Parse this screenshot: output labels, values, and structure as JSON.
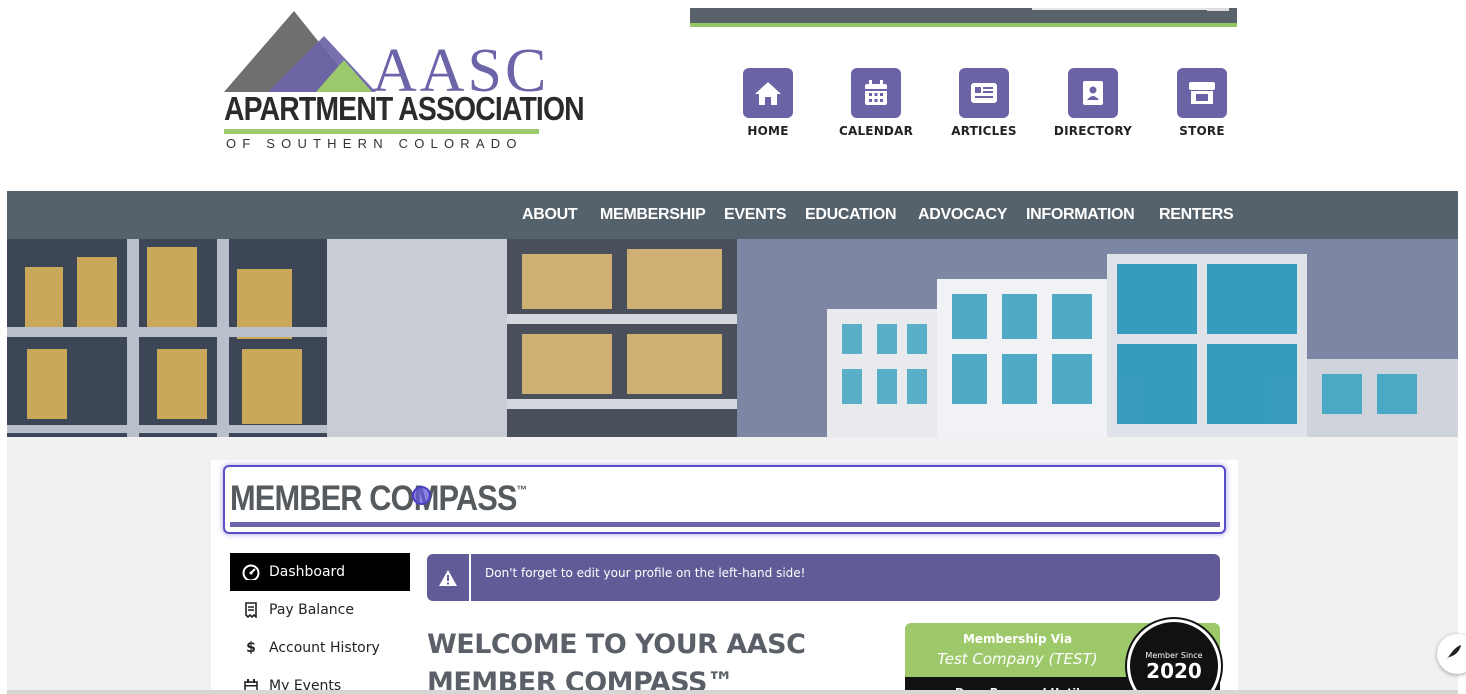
{
  "logo": {
    "abbr": "AASC",
    "line1": "APARTMENT ASSOCIATION",
    "line2": "OF SOUTHERN COLORADO",
    "colors": {
      "purple": "#6b64a8",
      "green": "#9cc96b",
      "gray": "#6f6f6f"
    }
  },
  "quick_links": [
    {
      "label": "HOME",
      "icon": "home-icon"
    },
    {
      "label": "CALENDAR",
      "icon": "calendar-icon"
    },
    {
      "label": "ARTICLES",
      "icon": "newspaper-icon"
    },
    {
      "label": "DIRECTORY",
      "icon": "address-book-icon"
    },
    {
      "label": "STORE",
      "icon": "store-icon"
    }
  ],
  "nav": {
    "items": [
      "ABOUT",
      "MEMBERSHIP",
      "EVENTS",
      "EDUCATION",
      "ADVOCACY",
      "INFORMATION",
      "RENTERS"
    ],
    "background": "#56626b"
  },
  "page": {
    "title": "MEMBER COMPASS",
    "title_mark": "™"
  },
  "sidebar": {
    "items": [
      {
        "label": "Dashboard",
        "icon": "dashboard-icon",
        "active": true
      },
      {
        "label": "Pay Balance",
        "icon": "receipt-icon",
        "active": false
      },
      {
        "label": "Account History",
        "icon": "dollar-icon",
        "active": false
      },
      {
        "label": "My Events",
        "icon": "calendar-icon",
        "active": false
      }
    ]
  },
  "alert": {
    "icon": "warning-icon",
    "text": "Don't forget to edit your profile on the left-hand side!",
    "color": "#615c97"
  },
  "welcome": {
    "line1": "WELCOME TO YOUR AASC",
    "line2": "MEMBER COMPASS™"
  },
  "membership": {
    "via_label": "Membership Via",
    "company": "Test Company (TEST)",
    "dues_label": "Dues Renewed Until",
    "since_label": "Member Since",
    "since_year": "2020",
    "color": "#9dc96b"
  }
}
